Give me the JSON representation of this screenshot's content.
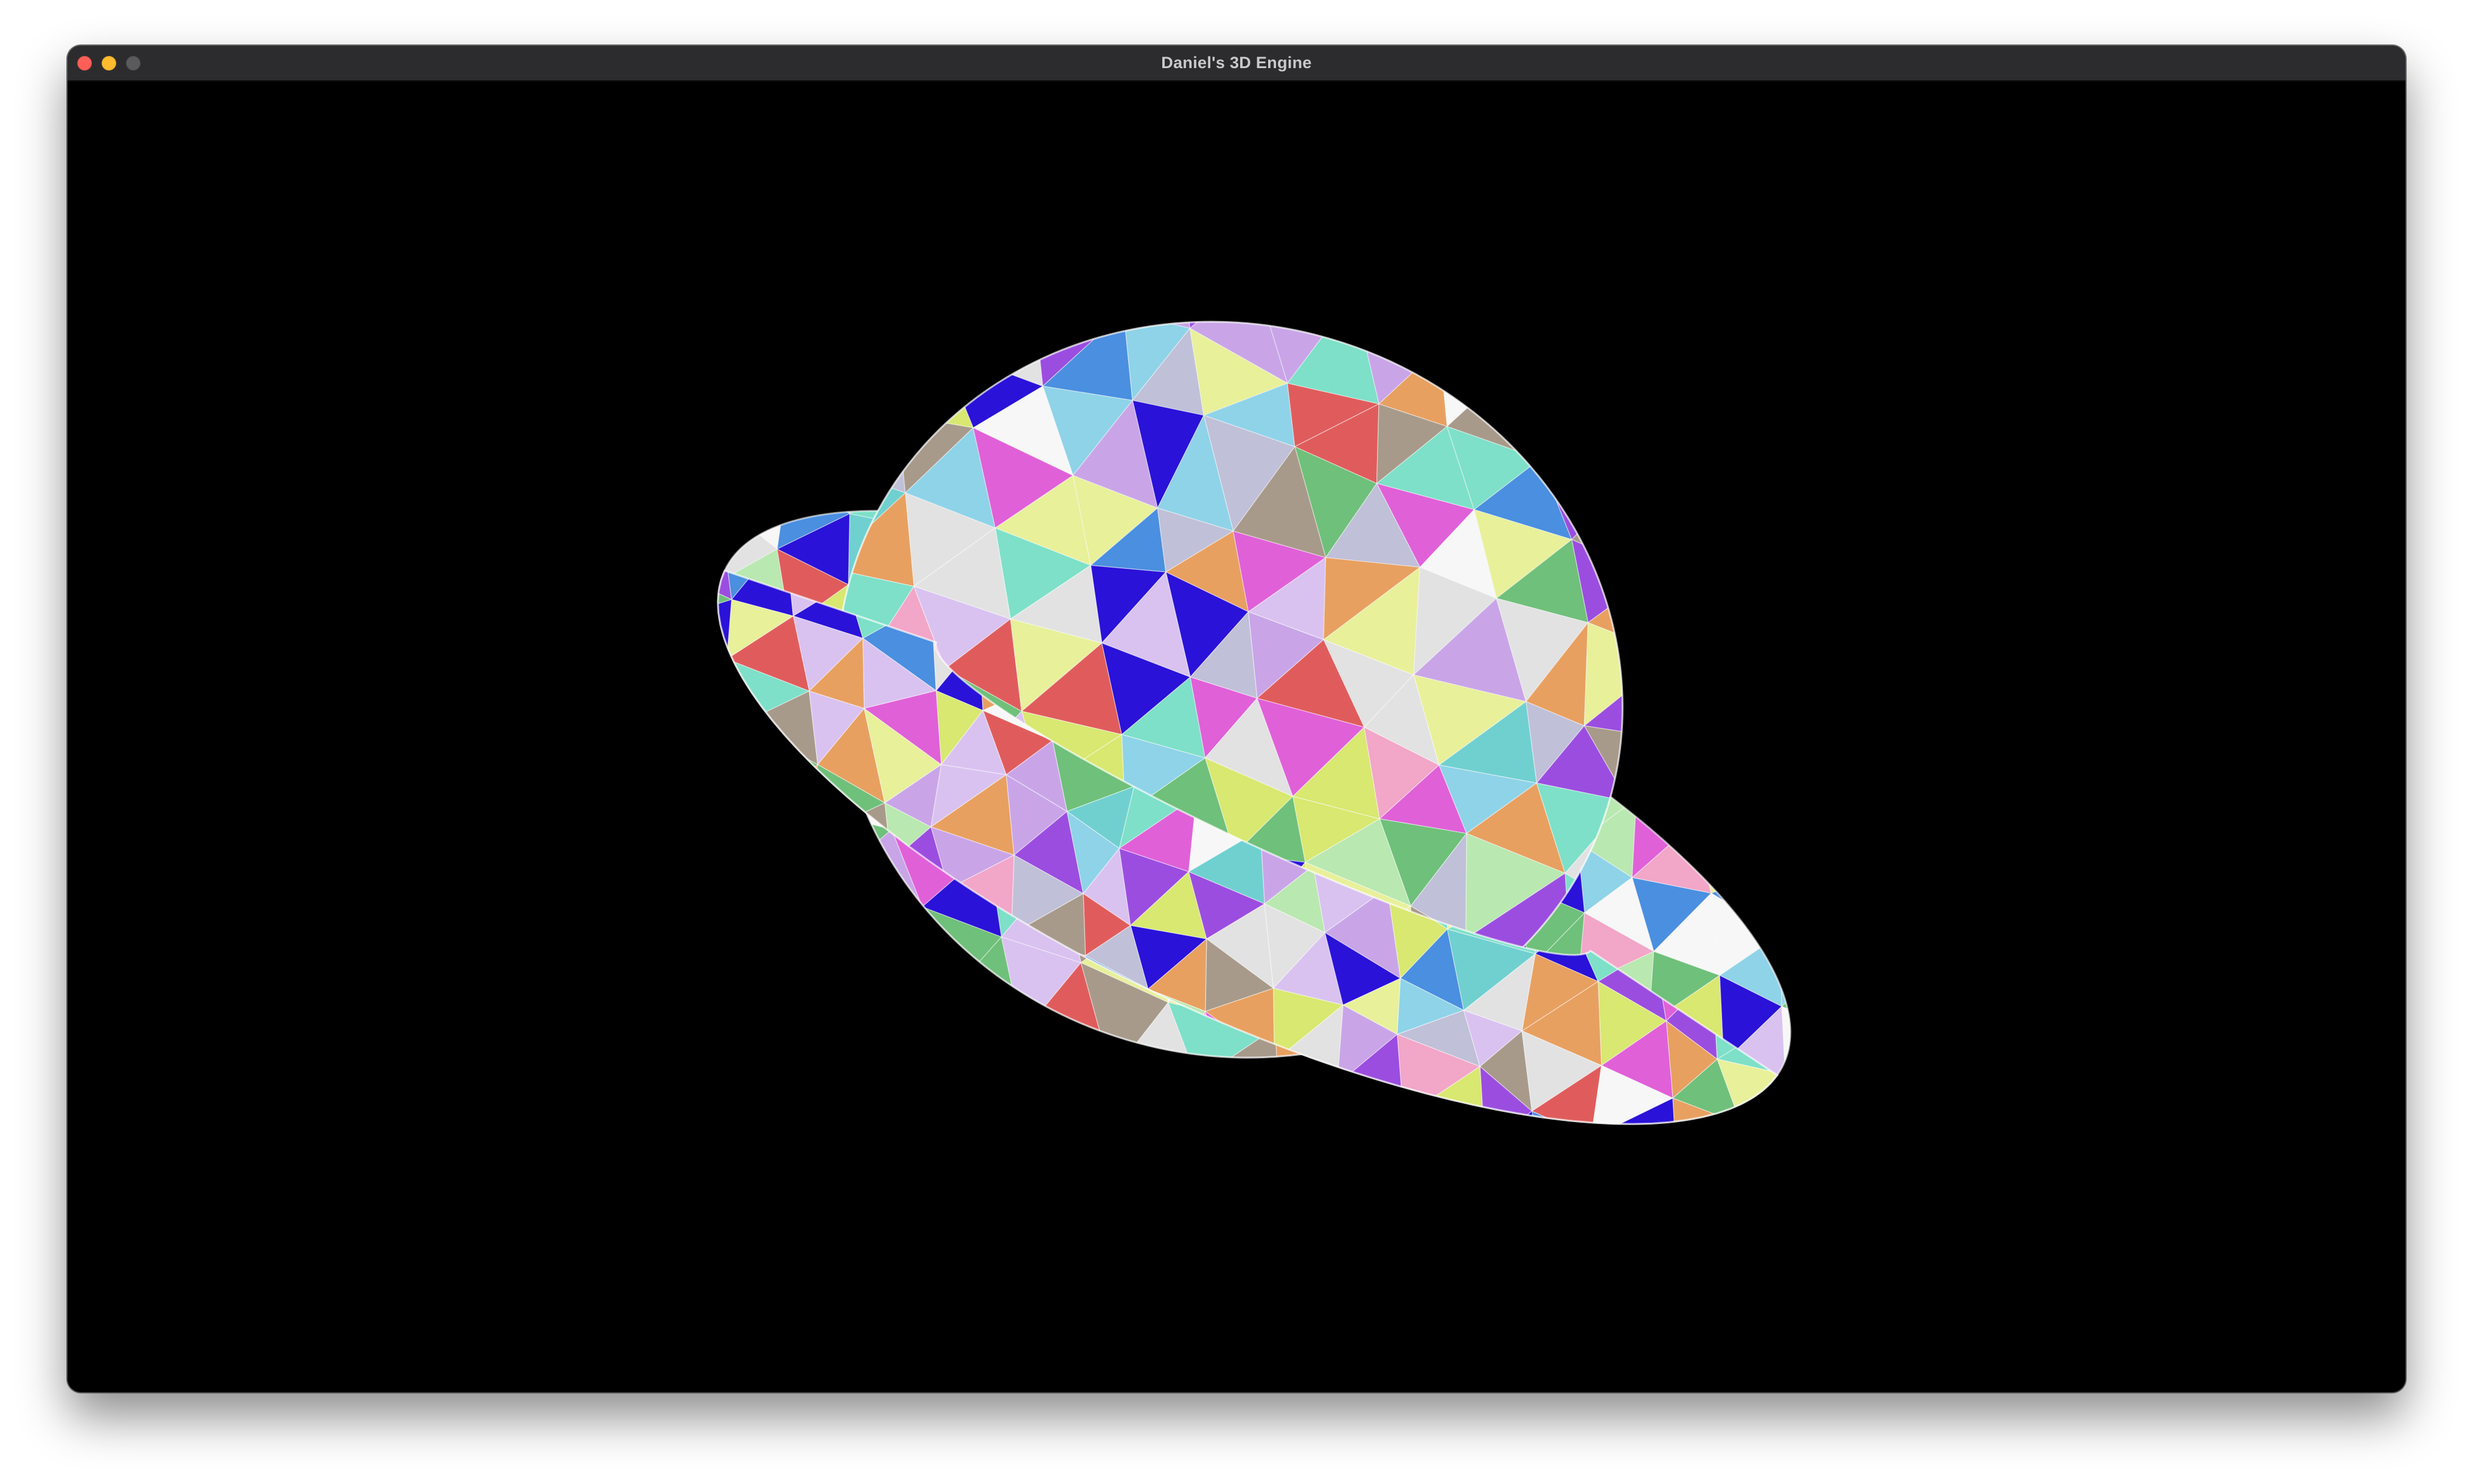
{
  "window": {
    "title": "Daniel's 3D Engine",
    "controls": {
      "close_color": "#ff5f57",
      "minimize_color": "#febc2e",
      "zoom_color": "#5a5a5c"
    }
  },
  "viewport": {
    "background": "#000000",
    "scene": {
      "description_icon": "low-poly-planet-with-ring",
      "render_style": "flat-shaded-random-color-triangles",
      "palette": [
        "#e2e2e2",
        "#c9a5e8",
        "#7ee0c8",
        "#e8f09a",
        "#f2a6c8",
        "#8fd3e8",
        "#b9e8b0",
        "#d9c2f0",
        "#f7f7f7",
        "#e05c5c",
        "#9b4de0",
        "#4a8fe0",
        "#2a12d8",
        "#a89a8a",
        "#6fc07a",
        "#e8a060",
        "#e060d8",
        "#70d0d0",
        "#c0c0d8",
        "#d8e870"
      ]
    }
  }
}
